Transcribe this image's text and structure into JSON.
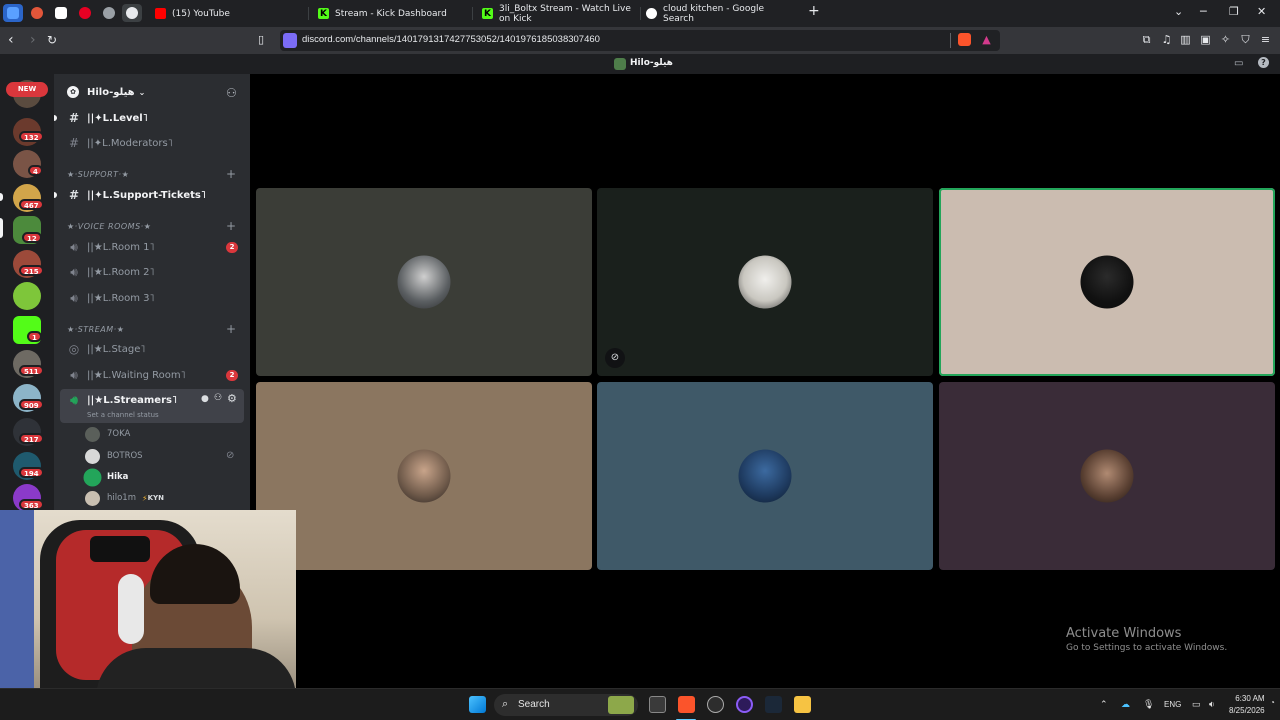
{
  "browser": {
    "tabs": [
      {
        "label": "(15) YouTube",
        "color": "#ff0000"
      },
      {
        "label": "Stream - Kick Dashboard",
        "color": "#53fc18"
      },
      {
        "label": "3li_Boltx Stream - Watch Live on Kick",
        "color": "#53fc18"
      },
      {
        "label": "cloud kitchen - Google Search",
        "color": "#ffffff"
      }
    ],
    "new_tab": "+",
    "url": "discord.com/channels/1401791317427753052/1401976185038307460"
  },
  "discord": {
    "window_title": "Hilo-هيلو",
    "server_name": "Hilo-هيلو",
    "new_label": "NEW",
    "rail_badges": [
      "132",
      "4",
      "467",
      "12",
      "215",
      "1",
      "511",
      "909",
      "217",
      "194",
      "363"
    ],
    "channels": {
      "level": "||✦L.Level˥",
      "moderators": "||✦L.Moderators˥",
      "cat_support": "★·SUPPORT·★",
      "support_tickets": "||✦L.Support-Tickets˥",
      "cat_voice": "★·VOICE ROOMS·★",
      "room1": "||★L.Room 1˥",
      "room1_count": "2",
      "room2": "||★L.Room 2˥",
      "room3": "||★L.Room 3˥",
      "cat_stream": "★·STREAM·★",
      "stage": "||★L.Stage˥",
      "waiting": "||★L.Waiting Room˥",
      "waiting_count": "2",
      "streamers": "||★L.Streamers˥",
      "status_hint": "Set a channel status"
    },
    "members": [
      {
        "name": "7OKA"
      },
      {
        "name": "BOTROS"
      },
      {
        "name": "Hika"
      },
      {
        "name": "hilo1m",
        "tag": "KYN"
      }
    ]
  },
  "watermark": {
    "line1": "Activate Windows",
    "line2": "Go to Settings to activate Windows."
  },
  "taskbar": {
    "search": "Search",
    "lang": "ENG",
    "time": "6:30 AM",
    "date": "8/25/2026"
  }
}
